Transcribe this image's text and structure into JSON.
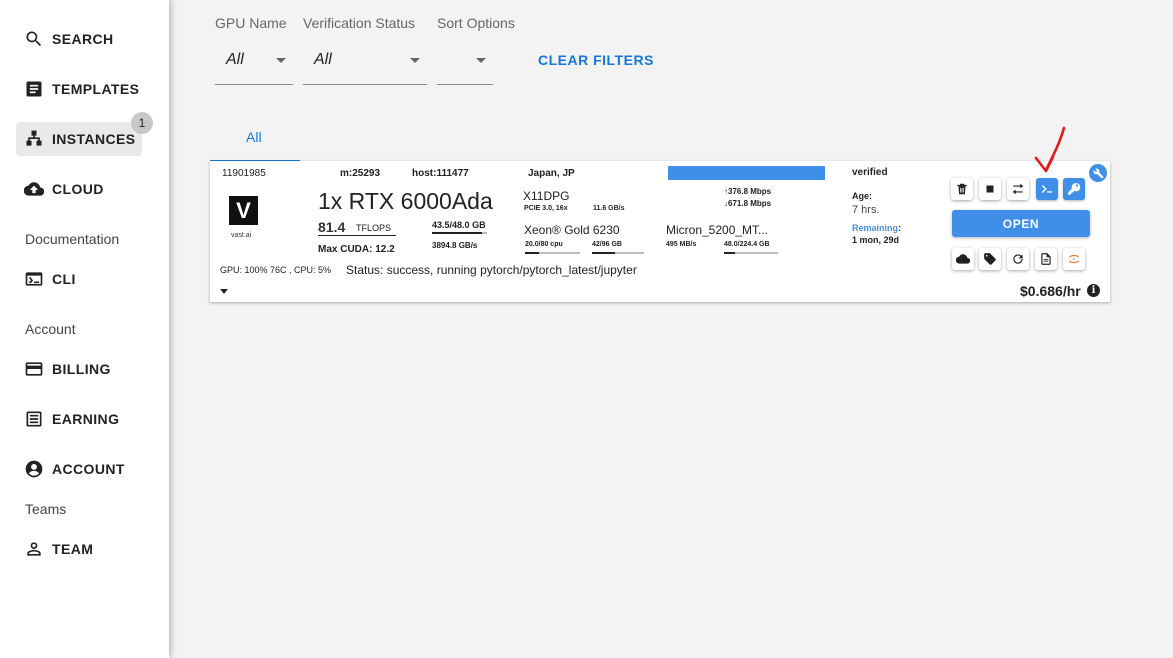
{
  "sidebar": {
    "items": [
      {
        "label": "SEARCH",
        "icon": "search-icon"
      },
      {
        "label": "TEMPLATES",
        "icon": "templates-icon"
      },
      {
        "label": "INSTANCES",
        "icon": "instances-icon",
        "badge": "1"
      },
      {
        "label": "CLOUD",
        "icon": "cloud-upload-icon"
      },
      {
        "label": "CLI",
        "icon": "terminal-icon"
      },
      {
        "label": "BILLING",
        "icon": "credit-card-icon"
      },
      {
        "label": "EARNING",
        "icon": "list-icon"
      },
      {
        "label": "ACCOUNT",
        "icon": "account-circle-icon"
      },
      {
        "label": "TEAM",
        "icon": "person-icon"
      }
    ],
    "sections": [
      "Documentation",
      "Account",
      "Teams"
    ]
  },
  "filters": {
    "gpu_name": {
      "label": "GPU Name",
      "value": "All"
    },
    "verification": {
      "label": "Verification Status",
      "value": "All"
    },
    "sort": {
      "label": "Sort Options",
      "value": ""
    },
    "clear_label": "CLEAR FILTERS"
  },
  "tabs": [
    {
      "label": "All"
    }
  ],
  "instance": {
    "id": "11901985",
    "machine": "m:25293",
    "host": "host:111477",
    "location": "Japan, JP",
    "provider_logo": "V",
    "provider_name": "vast.ai",
    "gpu_title": "1x RTX 6000Ada",
    "tflops_value": "81.4",
    "tflops_unit": "TFLOPS",
    "max_cuda": "Max CUDA: 12.2",
    "vram": "43.5/48.0",
    "vram_unit": "GB",
    "vram_usage_fraction": 0.906,
    "bandwidth": "3894.8 GB/s",
    "motherboard": "X11DPG",
    "pcie": "PCIE 3.0, 16x",
    "pcie_speed": "11.6 GB/s",
    "cpu_name": "Xeon® Gold 6230",
    "cpu_usage": "20.0/80 cpu",
    "cpu_usage_fraction": 0.25,
    "ram_usage": "42/96 GB",
    "ram_usage_fraction": 0.44,
    "upload": "376.8 Mbps",
    "download": "671.8 Mbps",
    "disk_name": "Micron_5200_MT...",
    "disk_speed": "495 MB/s",
    "disk_usage": "48.0/224.4 GB",
    "disk_usage_fraction": 0.21,
    "verified": "verified",
    "age_label": "Age:",
    "age_value": "7 hrs.",
    "remaining_label": "Remaining",
    "remaining_value": "1 mon, 29d",
    "gpu_stats": "GPU: 100% 76C , CPU: 5%",
    "status": "Status: success, running pytorch/pytorch_latest/jupyter",
    "open_label": "OPEN",
    "price": "$0.686/hr"
  },
  "colors": {
    "accent": "#1976d2",
    "button_blue": "#3f8ee8",
    "annotation_red": "#e01b1b"
  }
}
